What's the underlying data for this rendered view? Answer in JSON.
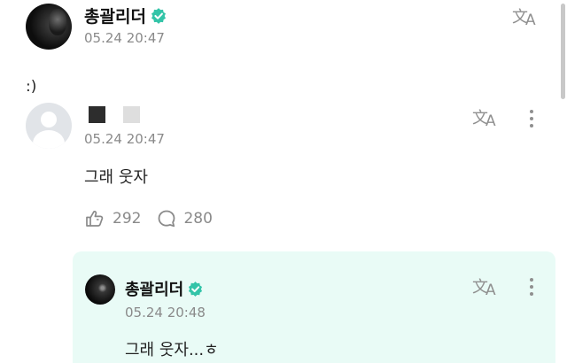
{
  "post": {
    "author": "총괄리더",
    "timestamp": "05.24 20:47",
    "text": ":)"
  },
  "replies": [
    {
      "timestamp": "05.24 20:47",
      "text": "그래 웃자",
      "likes": "292",
      "comments": "280"
    }
  ],
  "nested_reply": {
    "author": "총괄리더",
    "timestamp": "05.24 20:48",
    "text": "그래 웃자...ㅎ"
  },
  "colors": {
    "verified": "#33c4a8",
    "nested_bg": "#e9fbf6",
    "muted": "#8a8a8a"
  },
  "icons": [
    "verified-icon",
    "translate-icon",
    "more-icon",
    "like-icon",
    "comment-icon"
  ]
}
